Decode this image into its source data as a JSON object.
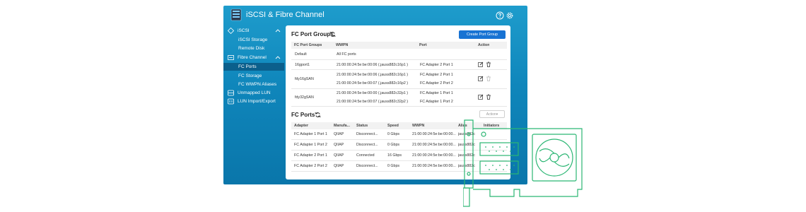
{
  "app": {
    "title": "iSCSI & Fibre Channel"
  },
  "sidebar": {
    "iscsi": "iSCSI",
    "iscsi_storage": "iSCSI Storage",
    "remote_disk": "Remote Disk",
    "fibre_channel": "Fibre Channel",
    "fc_ports": "FC Ports",
    "fc_storage": "FC Storage",
    "fc_wwpn_aliases": "FC WWPN Aliases",
    "unmapped_lun": "Unmapped LUN",
    "lun_import_export": "LUN Import/Export"
  },
  "port_groups": {
    "title": "FC Port Groups",
    "create_label": "Create Port Group",
    "headers": [
      "FC Port Groups",
      "WWPN",
      "Port",
      "Action"
    ],
    "rows": [
      {
        "group": "Default",
        "wwpn": [
          "All FC ports"
        ],
        "port": []
      },
      {
        "group": "16gport1",
        "wwpn": [
          "21:00:00:24:5e:be:00:06 (.jauss882c16p1 )"
        ],
        "port": [
          "FC Adapter 2 Port 1"
        ]
      },
      {
        "group": "fdy16gSAN",
        "wwpn": [
          "21:00:00:24:5e:be:00:06 (.jauss882c16p1 )",
          "21:00:00:24:5e:be:00:07 (.jauss882c16p2 )"
        ],
        "port": [
          "FC Adapter 2 Port 1",
          "FC Adapter 2 Port 2"
        ]
      },
      {
        "group": "fdy32gSAN",
        "wwpn": [
          "21:00:00:24:5e:be:00:00 (.jauss882c32p1 )",
          "21:00:00:24:5e:be:00:07 (.jauss882c32p2 )"
        ],
        "port": [
          "FC Adapter 1 Port 1",
          "FC Adapter 1 Port 2"
        ]
      }
    ]
  },
  "fc_ports": {
    "title": "FC Ports",
    "action_label": "Action",
    "headers": [
      "Adapter",
      "Manufa...",
      "Status",
      "Speed",
      "WWPN",
      "Alias",
      "Initiators"
    ],
    "rows": [
      {
        "adapter": "FC Adapter 1 Port 1",
        "manufacturer": "QIIAP",
        "status": "Disconnect...",
        "speed": "0 Gbps",
        "wwpn": "21:00:00:24:5e:be:00:00...",
        "alias": "jauss882c"
      },
      {
        "adapter": "FC Adapter 1 Port 2",
        "manufacturer": "QIIAP",
        "status": "Disconnect...",
        "speed": "0 Gbps",
        "wwpn": "21:00:00:24:5e:be:00:00...",
        "alias": "jauss882c"
      },
      {
        "adapter": "FC Adapter 2 Port 1",
        "manufacturer": "QIIAP",
        "status": "Connected",
        "speed": "16 Gbps",
        "wwpn": "21:00:00:24:5e:be:00:00...",
        "alias": "jauss882c"
      },
      {
        "adapter": "FC Adapter 2 Port 2",
        "manufacturer": "QIIAP",
        "status": "Disconnect...",
        "speed": "0 Gbps",
        "wwpn": "21:00:00:24:5e:be:00:00...",
        "alias": "jauss882c"
      }
    ]
  },
  "colors": {
    "window": "#0f86bb",
    "selected": "#0b5f8c",
    "primary": "#1873d3",
    "card_outline": "#2bb673"
  }
}
